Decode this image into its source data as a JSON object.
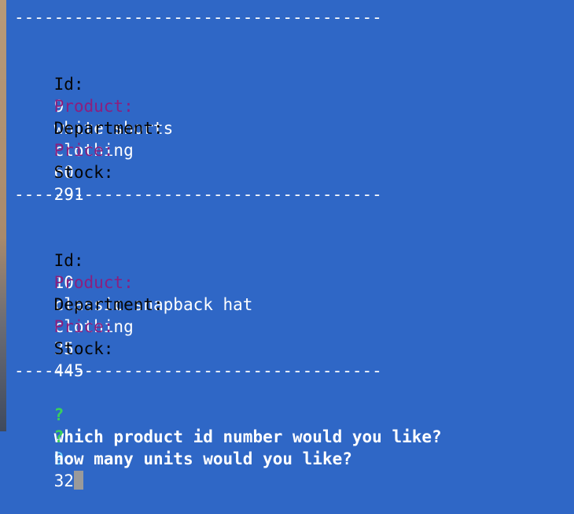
{
  "terminal": {
    "separator": "-------------------------------------",
    "records": [
      {
        "id_label": "Id:",
        "id_value": "9",
        "product_label": "Product:",
        "product_value": "white shorts",
        "department_label": "Department:",
        "department_value": "clothing",
        "price_label": "Price:",
        "price_value": "60",
        "stock_label": "Stock:",
        "stock_value": "291"
      },
      {
        "id_label": "Id:",
        "id_value": "10",
        "product_label": "Product:",
        "product_value": "classic snapback hat",
        "department_label": "Department:",
        "department_value": "clothing",
        "price_label": "Price:",
        "price_value": "35",
        "stock_label": "Stock:",
        "stock_value": "445"
      }
    ],
    "prompts": [
      {
        "marker": "?",
        "question": "which product id number would you like?",
        "answer": "9"
      },
      {
        "marker": "?",
        "question": "how many units would you like?",
        "answer": "32"
      }
    ]
  },
  "colors": {
    "background": "#2f67c6",
    "label_black": "#050505",
    "label_purple": "#8b1f7e",
    "value_white": "#ffffff",
    "prompt_green": "#39d15b",
    "answer_cyan": "#71d9ff",
    "cursor_gray": "#9a9a9a"
  }
}
